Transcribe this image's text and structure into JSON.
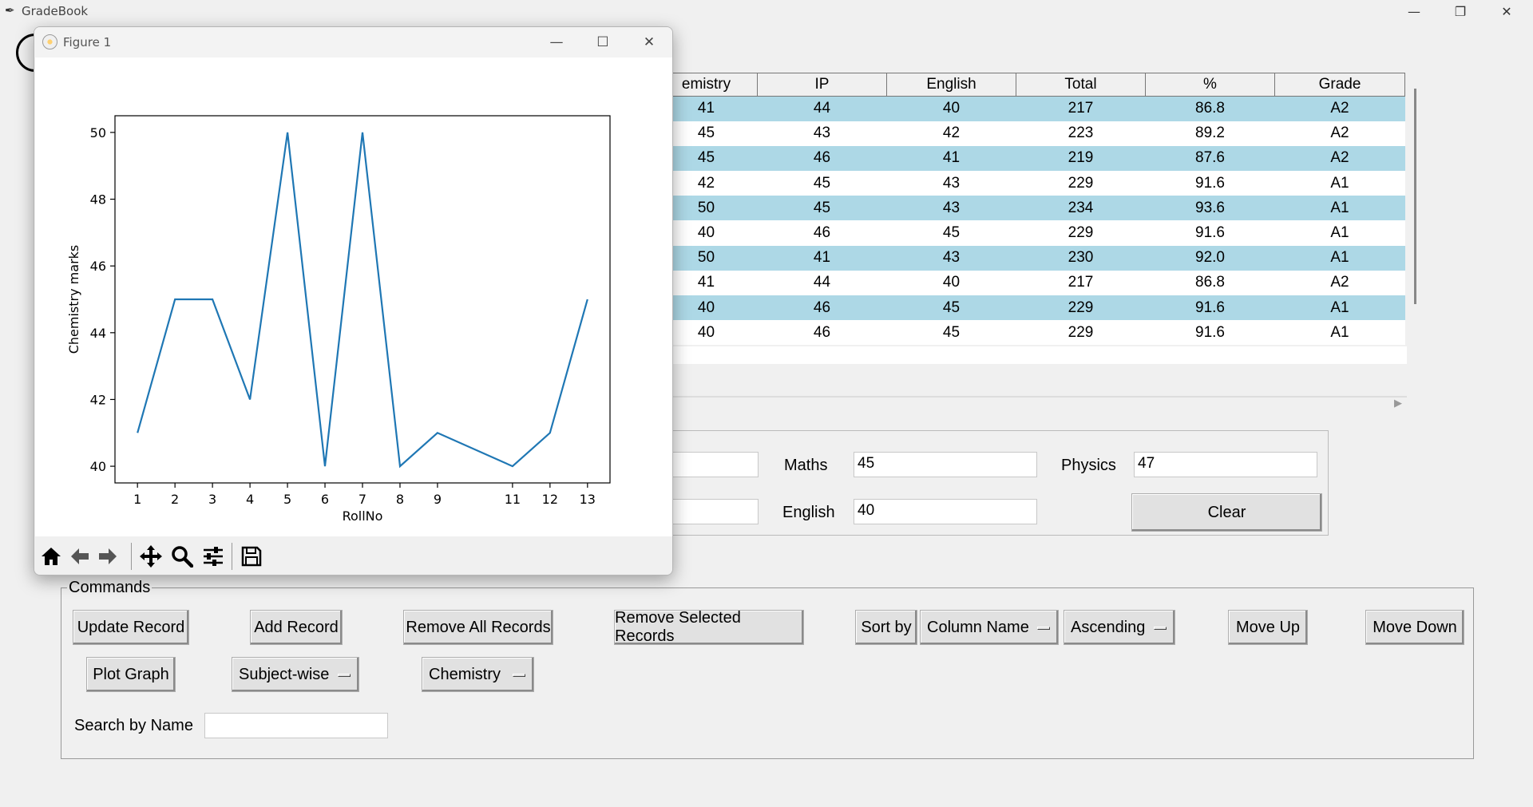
{
  "app": {
    "title": "GradeBook",
    "icon": "feather-icon"
  },
  "window_controls": {
    "minimize": "—",
    "restore": "❐",
    "close": "✕"
  },
  "table": {
    "headers": [
      "emistry",
      "IP",
      "English",
      "Total",
      "%",
      "Grade"
    ],
    "rows": [
      [
        "41",
        "44",
        "40",
        "217",
        "86.8",
        "A2"
      ],
      [
        "45",
        "43",
        "42",
        "223",
        "89.2",
        "A2"
      ],
      [
        "45",
        "46",
        "41",
        "219",
        "87.6",
        "A2"
      ],
      [
        "42",
        "45",
        "43",
        "229",
        "91.6",
        "A1"
      ],
      [
        "50",
        "45",
        "43",
        "234",
        "93.6",
        "A1"
      ],
      [
        "40",
        "46",
        "45",
        "229",
        "91.6",
        "A1"
      ],
      [
        "50",
        "41",
        "43",
        "230",
        "92.0",
        "A1"
      ],
      [
        "41",
        "44",
        "40",
        "217",
        "86.8",
        "A2"
      ],
      [
        "40",
        "46",
        "45",
        "229",
        "91.6",
        "A1"
      ],
      [
        "40",
        "46",
        "45",
        "229",
        "91.6",
        "A1"
      ]
    ]
  },
  "details": {
    "maths_label": "Maths",
    "maths_value": "45",
    "physics_label": "Physics",
    "physics_value": "47",
    "english_label": "English",
    "english_value": "40",
    "clear_label": "Clear"
  },
  "commands": {
    "legend": "Commands",
    "update_record": "Update Record",
    "add_record": "Add Record",
    "remove_all": "Remove All Records",
    "remove_selected": "Remove Selected Records",
    "sort_by": "Sort by",
    "sort_column": "Column Name",
    "sort_order": "Ascending",
    "move_up": "Move Up",
    "move_down": "Move Down",
    "plot_graph": "Plot Graph",
    "plot_mode": "Subject-wise",
    "plot_subject": "Chemistry",
    "search_label": "Search by Name",
    "search_value": ""
  },
  "figure": {
    "title": "Figure 1",
    "toolbar": [
      "home-icon",
      "back-arrow-icon",
      "forward-arrow-icon",
      "pan-icon",
      "zoom-icon",
      "configure-subplots-icon",
      "save-icon"
    ]
  },
  "chart_data": {
    "type": "line",
    "title": "",
    "xlabel": "RollNo",
    "ylabel": "Chemistry marks",
    "x": [
      1,
      2,
      3,
      4,
      5,
      6,
      7,
      8,
      9,
      11,
      12,
      13
    ],
    "series": [
      {
        "values": [
          41,
          45,
          45,
          42,
          50,
          40,
          50,
          40,
          41,
          40,
          41,
          45
        ],
        "color": "#1f77b4"
      }
    ],
    "x_ticks": [
      "1",
      "2",
      "3",
      "4",
      "5",
      "6",
      "7",
      "8",
      "9",
      "11",
      "12",
      "13"
    ],
    "y_ticks": [
      "40",
      "42",
      "44",
      "46",
      "48",
      "50"
    ],
    "xlim": [
      0.4,
      13.6
    ],
    "ylim": [
      39.5,
      50.5
    ],
    "grid": false
  }
}
